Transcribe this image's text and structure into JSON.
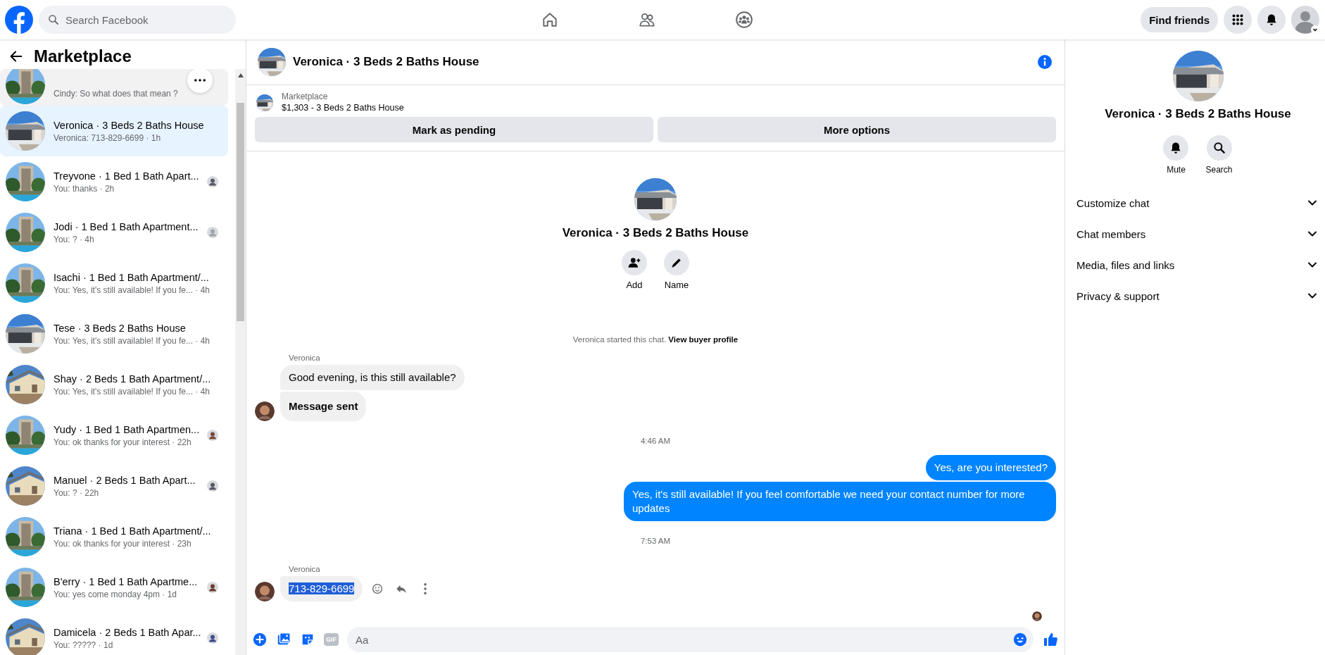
{
  "top_bar": {
    "search": {
      "placeholder": "Search Facebook"
    },
    "nav": [
      {
        "selected": false
      },
      {
        "selected": false
      },
      {
        "selected": false
      }
    ],
    "find_friends": "Find friends"
  },
  "sidebar": {
    "title": "Marketplace",
    "conversations": [
      {
        "subtitle": "Cindy: So what does that mean ?",
        "selected": false,
        "hovered": true,
        "seen": false
      },
      {
        "title": "Veronica · 3 Beds 2 Baths House",
        "subtitle": "Veronica: 713-829-6699 · 1h",
        "selected": true,
        "hovered": false,
        "seen": false
      },
      {
        "title": "Treyvone · 1 Bed 1 Bath Apart...",
        "subtitle": "You: thanks · 2h",
        "selected": false,
        "hovered": false,
        "seen": true
      },
      {
        "title": "Jodi · 1 Bed 1 Bath Apartment...",
        "subtitle": "You: ? · 4h",
        "selected": false,
        "hovered": false,
        "seen": true
      },
      {
        "title": "Isachi · 1 Bed 1 Bath Apartment/...",
        "subtitle": "You: Yes, it's still available! If you fe... · 4h",
        "selected": false,
        "hovered": false,
        "seen": false
      },
      {
        "title": "Tese · 3 Beds 2 Baths House",
        "subtitle": "You: Yes, it's still available! If you fe... · 4h",
        "selected": false,
        "hovered": false,
        "seen": false
      },
      {
        "title": "Shay · 2 Beds 1 Bath Apartment/...",
        "subtitle": "You: Yes, it's still available! If you fe... · 4h",
        "selected": false,
        "hovered": false,
        "seen": false
      },
      {
        "title": "Yudy · 1 Bed 1 Bath Apartmen...",
        "subtitle": "You: ok thanks for your interest · 22h",
        "selected": false,
        "hovered": false,
        "seen": true
      },
      {
        "title": "Manuel · 2 Beds 1 Bath Apart...",
        "subtitle": "You: ? · 22h",
        "selected": false,
        "hovered": false,
        "seen": true
      },
      {
        "title": "Triana · 1 Bed 1 Bath Apartment/...",
        "subtitle": "You: ok thanks for your interest · 23h",
        "selected": false,
        "hovered": false,
        "seen": false
      },
      {
        "title": "B'erry · 1 Bed 1 Bath Apartme...",
        "subtitle": "You: yes come monday 4pm · 1d",
        "selected": false,
        "hovered": false,
        "seen": true
      },
      {
        "title": "Damicela · 2 Beds 1 Bath Apar...",
        "subtitle": "You: ????? · 1d",
        "selected": false,
        "hovered": false,
        "seen": true
      }
    ]
  },
  "chat": {
    "title": "Veronica · 3 Beds 2 Baths House",
    "listing": {
      "source": "Marketplace",
      "summary": "$1,303 - 3 Beds 2 Baths House",
      "buttons": [
        "Mark as pending",
        "More options"
      ]
    },
    "intro": {
      "title": "Veronica · 3 Beds 2 Baths House",
      "actions": [
        {
          "label": "Add"
        },
        {
          "label": "Name"
        }
      ]
    },
    "thread": [
      {
        "kind": "system",
        "text": "Veronica started this chat.",
        "link": "View buyer profile"
      },
      {
        "kind": "sender",
        "text": "Veronica"
      },
      {
        "kind": "incoming",
        "text": "Good evening, is this still available?",
        "bold": false,
        "avatar": false,
        "highlighted": false,
        "actions": false
      },
      {
        "kind": "incoming",
        "text": "Message sent",
        "bold": true,
        "avatar": true,
        "highlighted": false,
        "actions": false
      },
      {
        "kind": "time",
        "text": "4:46 AM"
      },
      {
        "kind": "outgoing",
        "text": "Yes, are you interested?"
      },
      {
        "kind": "outgoing",
        "text": "Yes, it's still available! If you feel comfortable  we need your contact number for more updates"
      },
      {
        "kind": "time",
        "text": "7:53 AM"
      },
      {
        "kind": "sender",
        "text": "Veronica"
      },
      {
        "kind": "incoming",
        "text": "713-829-6699",
        "bold": false,
        "avatar": true,
        "highlighted": true,
        "actions": true
      }
    ],
    "seen": true,
    "composer": {
      "gif": "GIF",
      "placeholder": "Aa"
    }
  },
  "details": {
    "title": "Veronica · 3 Beds 2 Baths House",
    "actions": [
      {
        "label": "Mute"
      },
      {
        "label": "Search"
      }
    ],
    "sections": [
      {
        "label": "Customize chat",
        "expanded": false
      },
      {
        "label": "Chat members",
        "expanded": false
      },
      {
        "label": "Media, files and links",
        "expanded": false
      },
      {
        "label": "Privacy & support",
        "expanded": false
      }
    ]
  }
}
